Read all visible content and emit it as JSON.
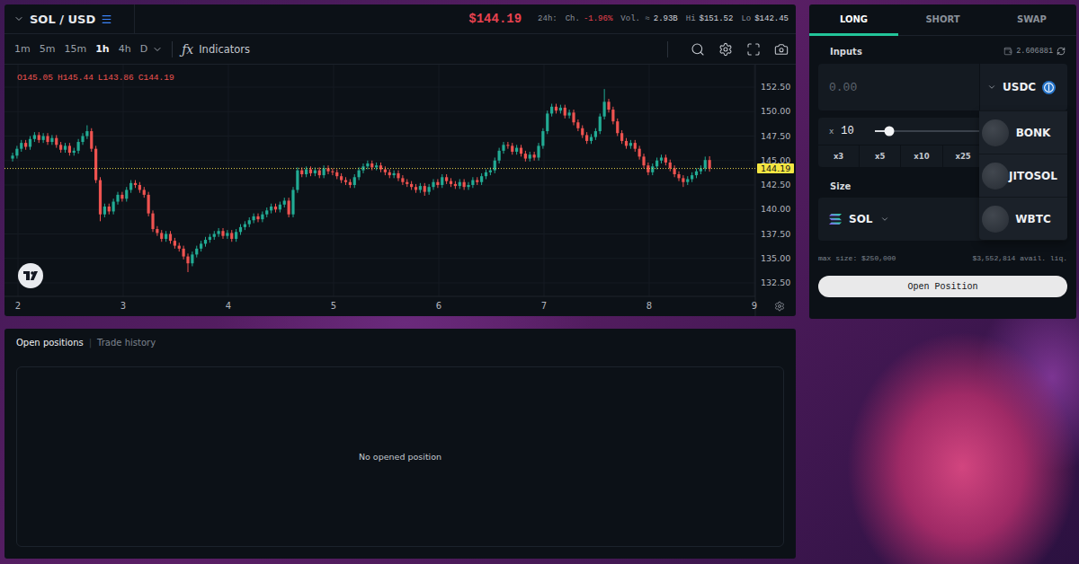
{
  "market": {
    "pair": "SOL / USD",
    "price": "$144.19",
    "period": "24h:",
    "stats": [
      {
        "label": "Ch.",
        "value": "-1.96%",
        "color": "#e8424f"
      },
      {
        "label": "Vol. ≈",
        "value": "2.93B",
        "color": "#d1d4dc"
      },
      {
        "label": "Hi",
        "value": "$151.52",
        "color": "#d1d4dc"
      },
      {
        "label": "Lo",
        "value": "$142.45",
        "color": "#d1d4dc"
      }
    ]
  },
  "toolbar": {
    "timeframes": [
      {
        "label": "1m",
        "selected": false
      },
      {
        "label": "5m",
        "selected": false
      },
      {
        "label": "15m",
        "selected": false
      },
      {
        "label": "1h",
        "selected": true
      },
      {
        "label": "4h",
        "selected": false
      },
      {
        "label": "D",
        "selected": false
      }
    ],
    "indicators_glyph": "ƒx",
    "indicators": "Indicators"
  },
  "chart": {
    "legend": [
      {
        "key": "O",
        "value": "145.05"
      },
      {
        "key": "H",
        "value": "145.44"
      },
      {
        "key": "L",
        "value": "143.86"
      },
      {
        "key": "C",
        "value": "144.19"
      }
    ],
    "price_ticks": [
      "152.50",
      "150.00",
      "147.50",
      "145.00",
      "142.50",
      "140.00",
      "137.50",
      "135.00",
      "132.50"
    ],
    "time_ticks": [
      "2",
      "3",
      "4",
      "5",
      "6",
      "7",
      "8",
      "9"
    ],
    "last_price": "144.19",
    "candles": [
      [
        145.2,
        145.8,
        144.9,
        145.5
      ],
      [
        145.5,
        146.5,
        145.2,
        146.2
      ],
      [
        146.2,
        147.1,
        145.9,
        146.8
      ],
      [
        146.8,
        147.1,
        146.1,
        146.4
      ],
      [
        146.4,
        147.5,
        146.1,
        147.2
      ],
      [
        147.2,
        147.9,
        146.9,
        147.6
      ],
      [
        147.6,
        147.9,
        146.8,
        147.1
      ],
      [
        147.1,
        147.8,
        146.8,
        147.5
      ],
      [
        147.5,
        147.8,
        146.6,
        146.9
      ],
      [
        146.9,
        147.6,
        146.6,
        147.3
      ],
      [
        147.3,
        147.6,
        146.3,
        146.6
      ],
      [
        146.6,
        146.9,
        145.8,
        146.1
      ],
      [
        146.1,
        146.8,
        145.8,
        146.5
      ],
      [
        146.5,
        146.8,
        145.5,
        145.8
      ],
      [
        145.8,
        146.3,
        145.5,
        146.0
      ],
      [
        146.0,
        147.2,
        145.7,
        146.9
      ],
      [
        146.9,
        147.8,
        146.6,
        147.5
      ],
      [
        147.5,
        148.6,
        147.2,
        148.0
      ],
      [
        148.0,
        148.3,
        145.9,
        146.2
      ],
      [
        146.2,
        146.5,
        142.7,
        143.0
      ],
      [
        143.0,
        143.3,
        138.8,
        139.5
      ],
      [
        139.5,
        140.6,
        139.2,
        140.3
      ],
      [
        140.3,
        140.6,
        139.5,
        139.8
      ],
      [
        139.8,
        141.1,
        139.5,
        140.8
      ],
      [
        140.8,
        141.8,
        140.5,
        141.5
      ],
      [
        141.5,
        141.8,
        140.8,
        141.1
      ],
      [
        141.1,
        142.3,
        140.8,
        142.0
      ],
      [
        142.0,
        143.0,
        141.7,
        142.7
      ],
      [
        142.7,
        143.0,
        142.2,
        142.5
      ],
      [
        142.5,
        142.8,
        141.7,
        142.0
      ],
      [
        142.0,
        142.3,
        141.2,
        141.5
      ],
      [
        141.5,
        141.8,
        139.3,
        139.6
      ],
      [
        139.6,
        139.9,
        137.7,
        138.0
      ],
      [
        138.0,
        138.3,
        137.3,
        137.6
      ],
      [
        137.6,
        137.9,
        136.7,
        137.0
      ],
      [
        137.0,
        137.8,
        136.7,
        137.5
      ],
      [
        137.5,
        137.8,
        136.5,
        136.8
      ],
      [
        136.8,
        137.1,
        136.0,
        136.3
      ],
      [
        136.3,
        136.6,
        135.7,
        136.0
      ],
      [
        136.0,
        136.3,
        134.9,
        135.2
      ],
      [
        135.2,
        135.5,
        133.6,
        134.5
      ],
      [
        134.5,
        135.7,
        134.2,
        135.4
      ],
      [
        135.4,
        136.3,
        135.1,
        136.0
      ],
      [
        136.0,
        136.8,
        135.7,
        136.5
      ],
      [
        136.5,
        137.2,
        136.2,
        136.9
      ],
      [
        136.9,
        137.5,
        136.6,
        137.2
      ],
      [
        137.2,
        137.8,
        136.9,
        137.5
      ],
      [
        137.5,
        138.1,
        137.2,
        137.8
      ],
      [
        137.8,
        138.1,
        137.0,
        137.3
      ],
      [
        137.3,
        137.9,
        137.0,
        137.6
      ],
      [
        137.6,
        137.9,
        136.7,
        137.0
      ],
      [
        137.0,
        138.0,
        136.7,
        137.7
      ],
      [
        137.7,
        138.5,
        137.4,
        138.2
      ],
      [
        138.2,
        138.8,
        137.9,
        138.5
      ],
      [
        138.5,
        139.2,
        138.2,
        138.9
      ],
      [
        138.9,
        139.6,
        138.6,
        139.3
      ],
      [
        139.3,
        139.6,
        138.7,
        139.0
      ],
      [
        139.0,
        139.8,
        138.7,
        139.5
      ],
      [
        139.5,
        140.2,
        139.2,
        139.9
      ],
      [
        139.9,
        140.6,
        139.6,
        140.3
      ],
      [
        140.3,
        140.6,
        139.7,
        140.0
      ],
      [
        140.0,
        140.8,
        139.7,
        140.5
      ],
      [
        140.5,
        141.2,
        140.2,
        140.9
      ],
      [
        140.9,
        141.2,
        139.2,
        139.5
      ],
      [
        139.5,
        142.3,
        139.2,
        142.0
      ],
      [
        142.0,
        144.3,
        141.7,
        144.0
      ],
      [
        144.0,
        144.3,
        143.3,
        143.6
      ],
      [
        143.6,
        144.4,
        143.3,
        144.1
      ],
      [
        144.1,
        144.4,
        143.4,
        143.7
      ],
      [
        143.7,
        144.3,
        143.4,
        144.0
      ],
      [
        144.0,
        144.3,
        143.2,
        143.5
      ],
      [
        143.5,
        144.5,
        143.2,
        144.2
      ],
      [
        144.2,
        144.5,
        143.6,
        143.9
      ],
      [
        143.9,
        144.2,
        143.5,
        143.8
      ],
      [
        143.8,
        144.1,
        143.1,
        143.4
      ],
      [
        143.4,
        143.7,
        142.7,
        143.0
      ],
      [
        143.0,
        143.3,
        142.5,
        142.8
      ],
      [
        142.8,
        143.1,
        142.2,
        142.5
      ],
      [
        142.5,
        143.6,
        142.2,
        143.3
      ],
      [
        143.3,
        144.3,
        143.0,
        144.0
      ],
      [
        144.0,
        144.7,
        143.7,
        144.4
      ],
      [
        144.4,
        145.0,
        144.1,
        144.7
      ],
      [
        144.7,
        145.0,
        144.0,
        144.3
      ],
      [
        144.3,
        144.8,
        144.0,
        144.5
      ],
      [
        144.5,
        144.8,
        143.8,
        144.1
      ],
      [
        144.1,
        144.4,
        143.5,
        143.8
      ],
      [
        143.8,
        144.1,
        143.2,
        143.5
      ],
      [
        143.5,
        144.0,
        143.2,
        143.7
      ],
      [
        143.7,
        144.0,
        142.9,
        143.2
      ],
      [
        143.2,
        143.5,
        142.5,
        142.8
      ],
      [
        142.8,
        143.1,
        142.3,
        142.6
      ],
      [
        142.6,
        142.9,
        142.0,
        142.3
      ],
      [
        142.3,
        142.6,
        141.7,
        142.0
      ],
      [
        142.0,
        142.7,
        141.7,
        142.4
      ],
      [
        142.4,
        142.7,
        141.4,
        141.8
      ],
      [
        141.8,
        142.6,
        141.5,
        142.3
      ],
      [
        142.3,
        143.1,
        142.0,
        142.8
      ],
      [
        142.8,
        143.1,
        142.2,
        142.5
      ],
      [
        142.5,
        143.6,
        142.2,
        143.3
      ],
      [
        143.3,
        143.6,
        142.6,
        142.9
      ],
      [
        142.9,
        143.2,
        142.3,
        142.6
      ],
      [
        142.6,
        142.9,
        142.1,
        142.4
      ],
      [
        142.4,
        143.1,
        142.1,
        142.8
      ],
      [
        142.8,
        143.1,
        142.0,
        142.3
      ],
      [
        142.3,
        142.8,
        142.0,
        142.5
      ],
      [
        142.5,
        143.3,
        142.2,
        143.0
      ],
      [
        143.0,
        143.3,
        142.5,
        142.8
      ],
      [
        142.8,
        143.7,
        142.5,
        143.4
      ],
      [
        143.4,
        144.1,
        143.1,
        143.8
      ],
      [
        143.8,
        144.3,
        143.5,
        144.0
      ],
      [
        144.0,
        145.3,
        143.7,
        145.0
      ],
      [
        145.0,
        146.3,
        144.7,
        146.0
      ],
      [
        146.0,
        146.9,
        145.7,
        146.6
      ],
      [
        146.6,
        146.9,
        146.2,
        146.5
      ],
      [
        146.5,
        146.8,
        145.6,
        145.9
      ],
      [
        145.9,
        146.6,
        145.6,
        146.3
      ],
      [
        146.3,
        146.6,
        145.4,
        145.7
      ],
      [
        145.7,
        146.0,
        144.9,
        145.2
      ],
      [
        145.2,
        145.9,
        144.9,
        145.6
      ],
      [
        145.6,
        145.9,
        145.0,
        145.3
      ],
      [
        145.3,
        146.8,
        145.0,
        146.5
      ],
      [
        146.5,
        148.3,
        146.2,
        148.0
      ],
      [
        148.0,
        150.1,
        147.7,
        149.8
      ],
      [
        149.8,
        150.8,
        149.5,
        150.5
      ],
      [
        150.5,
        150.8,
        149.8,
        150.1
      ],
      [
        150.1,
        150.7,
        149.8,
        150.4
      ],
      [
        150.4,
        150.7,
        149.3,
        149.6
      ],
      [
        149.6,
        150.2,
        149.3,
        149.9
      ],
      [
        149.9,
        150.2,
        148.6,
        148.9
      ],
      [
        148.9,
        149.2,
        148.0,
        148.3
      ],
      [
        148.3,
        148.6,
        147.3,
        147.6
      ],
      [
        147.6,
        147.9,
        146.7,
        147.0
      ],
      [
        147.0,
        147.7,
        146.7,
        147.4
      ],
      [
        147.4,
        148.3,
        147.1,
        148.0
      ],
      [
        148.0,
        149.8,
        147.7,
        149.5
      ],
      [
        149.5,
        152.3,
        149.2,
        151.0
      ],
      [
        151.0,
        151.3,
        149.9,
        150.2
      ],
      [
        150.2,
        150.5,
        148.7,
        149.0
      ],
      [
        149.0,
        149.3,
        147.5,
        147.8
      ],
      [
        147.8,
        148.1,
        146.7,
        147.0
      ],
      [
        147.0,
        147.3,
        146.2,
        146.5
      ],
      [
        146.5,
        147.1,
        146.2,
        146.8
      ],
      [
        146.8,
        147.1,
        145.9,
        146.2
      ],
      [
        146.2,
        146.5,
        145.1,
        145.4
      ],
      [
        145.4,
        145.7,
        144.2,
        144.5
      ],
      [
        144.5,
        144.8,
        143.5,
        143.8
      ],
      [
        143.8,
        144.7,
        143.5,
        144.4
      ],
      [
        144.4,
        145.3,
        144.1,
        145.0
      ],
      [
        145.0,
        145.6,
        144.7,
        145.3
      ],
      [
        145.3,
        145.6,
        144.5,
        144.8
      ],
      [
        144.8,
        145.1,
        143.9,
        144.2
      ],
      [
        144.2,
        144.5,
        143.3,
        143.6
      ],
      [
        143.6,
        143.9,
        142.9,
        143.2
      ],
      [
        143.2,
        143.5,
        142.3,
        142.8
      ],
      [
        142.8,
        143.4,
        142.5,
        143.1
      ],
      [
        143.1,
        143.8,
        142.8,
        143.5
      ],
      [
        143.5,
        144.2,
        143.2,
        143.9
      ],
      [
        143.9,
        144.5,
        143.6,
        144.2
      ],
      [
        144.2,
        145.4,
        143.9,
        145.05
      ],
      [
        145.05,
        145.44,
        143.86,
        144.19
      ]
    ]
  },
  "trade": {
    "tabs": [
      {
        "label": "LONG",
        "selected": true
      },
      {
        "label": "SHORT",
        "selected": false
      },
      {
        "label": "SWAP",
        "selected": false
      }
    ],
    "inputs_label": "Inputs",
    "balance": "2.606881",
    "amount_placeholder": "0.00",
    "pay_token": "USDC",
    "leverage": {
      "prefix": "x",
      "value": "10",
      "level": 0.08,
      "presets": [
        "x3",
        "x5",
        "x10",
        "x25"
      ]
    },
    "token_menu": {
      "open": true,
      "items": [
        "BONK",
        "JITOSOL",
        "WBTC"
      ]
    },
    "size_label": "Size",
    "size_token": "SOL",
    "max_size": "max size: $250,000",
    "liquidity": "$3,552,814 avail. liq.",
    "submit": "Open Position"
  },
  "positions": {
    "tabs": [
      {
        "label": "Open positions",
        "selected": true
      },
      {
        "label": "Trade history",
        "selected": false
      }
    ],
    "separator": "|",
    "empty": "No opened position"
  }
}
